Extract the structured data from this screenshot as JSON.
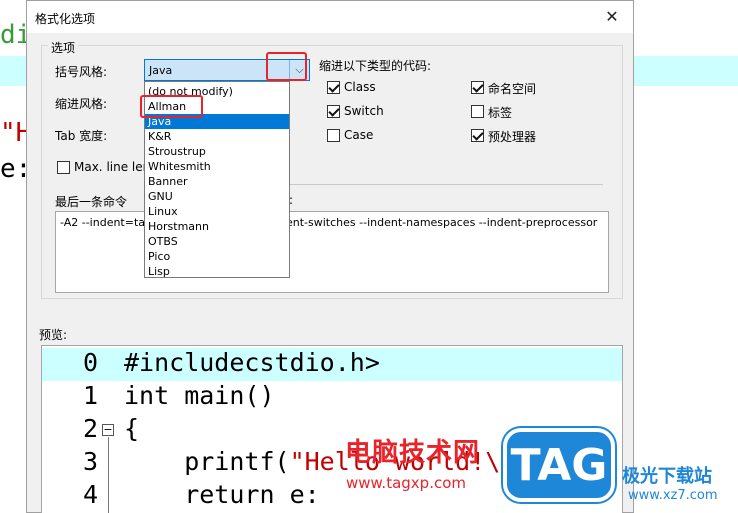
{
  "background_editor": {
    "lines": [
      "dio",
      "",
      "\"He",
      "e:"
    ]
  },
  "dialog": {
    "title": "格式化选项",
    "close_glyph": "✕",
    "group_label": "选项",
    "brace_style_label": "括号风格:",
    "indent_style_label": "缩进风格:",
    "tab_width_label": "Tab 宽度:",
    "max_line_length_label": "Max. line leng",
    "brace_style_value": "Java",
    "brace_style_options": [
      "(do not modify)",
      "Allman",
      "Java",
      "K&R",
      "Stroustrup",
      "Whitesmith",
      "Banner",
      "GNU",
      "Linux",
      "Horstmann",
      "OTBS",
      "Pico",
      "Lisp"
    ],
    "brace_style_selected": "Java",
    "indent_types_label": "缩进以下类型的代码:",
    "indent_types": [
      {
        "label": "Class",
        "checked": true
      },
      {
        "label": "命名空间",
        "checked": true
      },
      {
        "label": "Switch",
        "checked": true
      },
      {
        "label": "标签",
        "checked": false
      },
      {
        "label": "Case",
        "checked": false
      },
      {
        "label": "预处理器",
        "checked": true
      }
    ],
    "last_command_label": "最后一条命令",
    "last_command_label_suffix": ":",
    "last_command_left": "-A2 --indent=ta",
    "last_command_right": "ent-switches --indent-namespaces --indent-preprocessor",
    "preview_label": "预览:",
    "preview_lines": [
      {
        "num": "0",
        "code": "#includecstdio.h>"
      },
      {
        "num": "1",
        "code": "int main()"
      },
      {
        "num": "2",
        "code": "{"
      },
      {
        "num": "3",
        "code_prefix": "    printf(",
        "code_str": "\"Hello world!\\n\""
      },
      {
        "num": "4",
        "code": "    return e:"
      }
    ]
  },
  "watermark": {
    "cn_text": "电脑技术网",
    "url": "www.tagxp.com",
    "tag_text": "TAG",
    "site_name": "极光下载站",
    "site_url": "www.xz7.com"
  },
  "colors": {
    "accent": "#0078d7",
    "annotation_red": "#e8242a",
    "current_line": "#ccffff",
    "watermark_blue": "#1e87d8"
  }
}
